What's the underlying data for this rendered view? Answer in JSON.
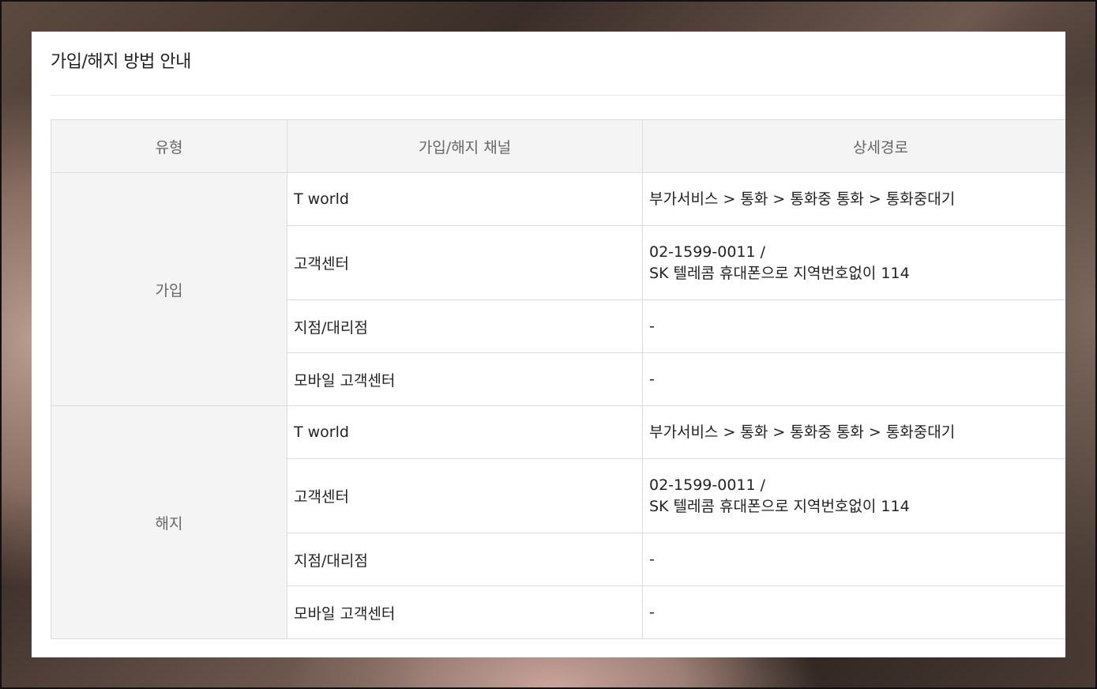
{
  "panel": {
    "title": "가입/해지 방법 안내"
  },
  "table": {
    "headers": {
      "type": "유형",
      "channel": "가입/해지 채널",
      "path": "상세경로"
    },
    "groups": [
      {
        "type": "가입",
        "rows": [
          {
            "channel": "T world",
            "path": [
              "부가서비스 > 통화 > 통화중 통화 > 통화중대기"
            ]
          },
          {
            "channel": "고객센터",
            "path": [
              "02-1599-0011 /",
              "SK 텔레콤 휴대폰으로 지역번호없이 114"
            ]
          },
          {
            "channel": "지점/대리점",
            "path": [
              "-"
            ]
          },
          {
            "channel": "모바일 고객센터",
            "path": [
              "-"
            ]
          }
        ]
      },
      {
        "type": "해지",
        "rows": [
          {
            "channel": "T world",
            "path": [
              "부가서비스 > 통화 > 통화중 통화 > 통화중대기"
            ]
          },
          {
            "channel": "고객센터",
            "path": [
              "02-1599-0011 /",
              "SK 텔레콤 휴대폰으로 지역번호없이 114"
            ]
          },
          {
            "channel": "지점/대리점",
            "path": [
              "-"
            ]
          },
          {
            "channel": "모바일 고객센터",
            "path": [
              "-"
            ]
          }
        ]
      }
    ]
  },
  "colors": {
    "header_bg": "#f4f4f4",
    "border": "#dcdcdc",
    "text": "#222222",
    "muted_text": "#666666"
  }
}
